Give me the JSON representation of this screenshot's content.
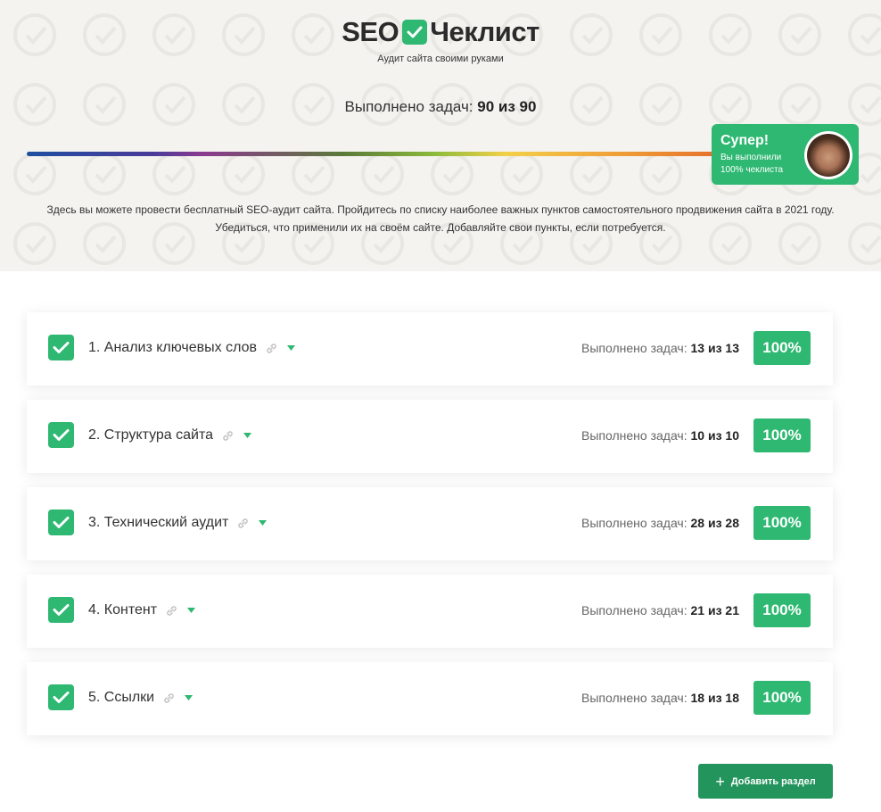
{
  "brand": {
    "seo": "SEO",
    "word": "Чеклист",
    "tagline": "Аудит сайта своими руками"
  },
  "summary": {
    "label": "Выполнено задач:",
    "value": "90 из 90",
    "progress_fraction": 1.0
  },
  "badge": {
    "title": "Супер!",
    "line1": "Вы выполнили",
    "line2": "100% чеклиста"
  },
  "intro": {
    "line1": "Здесь вы можете провести бесплатный SEO-аудит сайта. Пройдитесь по списку наиболее важных пунктов самостоятельного продвижения сайта в 2021 году.",
    "line2": "Убедиться, что применили их на своём сайте. Добавляйте свои пункты, если потребуется."
  },
  "sections": [
    {
      "title": "1. Анализ ключевых слов",
      "stats_label": "Выполнено задач:",
      "stats_value": "13 из 13",
      "percent": "100%"
    },
    {
      "title": "2. Структура сайта",
      "stats_label": "Выполнено задач:",
      "stats_value": "10 из 10",
      "percent": "100%"
    },
    {
      "title": "3. Технический аудит",
      "stats_label": "Выполнено задач:",
      "stats_value": "28 из 28",
      "percent": "100%"
    },
    {
      "title": "4. Контент",
      "stats_label": "Выполнено задач:",
      "stats_value": "21 из 21",
      "percent": "100%"
    },
    {
      "title": "5. Ссылки",
      "stats_label": "Выполнено задач:",
      "stats_value": "18 из 18",
      "percent": "100%"
    }
  ],
  "add_section": {
    "label": "Добавить раздел",
    "icon": "plus-icon"
  },
  "colors": {
    "accent": "#2eb872",
    "button": "#23945c",
    "hero_bg": "#f4f3f0"
  }
}
